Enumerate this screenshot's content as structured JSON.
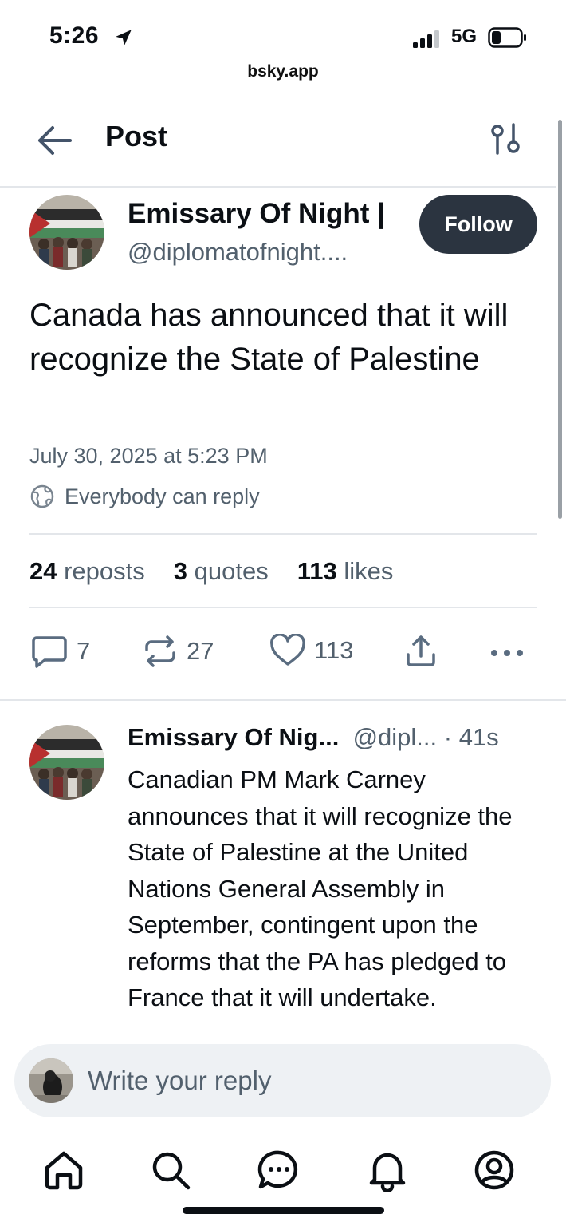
{
  "status_bar": {
    "time": "5:26",
    "network": "5G"
  },
  "browser": {
    "url": "bsky.app"
  },
  "header": {
    "title": "Post"
  },
  "post": {
    "author_name": "Emissary Of Night |",
    "author_handle": "@diplomatofnight....",
    "follow_label": "Follow",
    "text": "Canada has announced that it will recognize the State of Palestine",
    "timestamp": "July 30, 2025 at 5:23 PM",
    "reply_permission": "Everybody can reply",
    "stats": {
      "reposts_count": "24",
      "reposts_label": "reposts",
      "quotes_count": "3",
      "quotes_label": "quotes",
      "likes_count": "113",
      "likes_label": "likes"
    },
    "actions": {
      "reply_count": "7",
      "repost_count": "27",
      "like_count": "113"
    }
  },
  "reply": {
    "author_name": "Emissary Of Nig...",
    "author_handle": "@dipl...",
    "separator": "·",
    "time": "41s",
    "text": "Canadian PM Mark Carney announces that it will recognize the State of Palestine at the United Nations General Assembly in September, contingent upon the reforms that the PA has pledged to France that it will undertake."
  },
  "composer": {
    "placeholder": "Write your reply"
  },
  "colors": {
    "follow_bg": "#2b3440",
    "muted_text": "#52606d",
    "divider": "#e3e6ea",
    "composer_bg": "#eef1f4"
  },
  "icons": {
    "nav": [
      "home-icon",
      "search-icon",
      "chat-icon",
      "bell-icon",
      "profile-icon"
    ],
    "actions": [
      "reply-icon",
      "repost-icon",
      "like-icon",
      "share-icon",
      "more-icon"
    ]
  }
}
